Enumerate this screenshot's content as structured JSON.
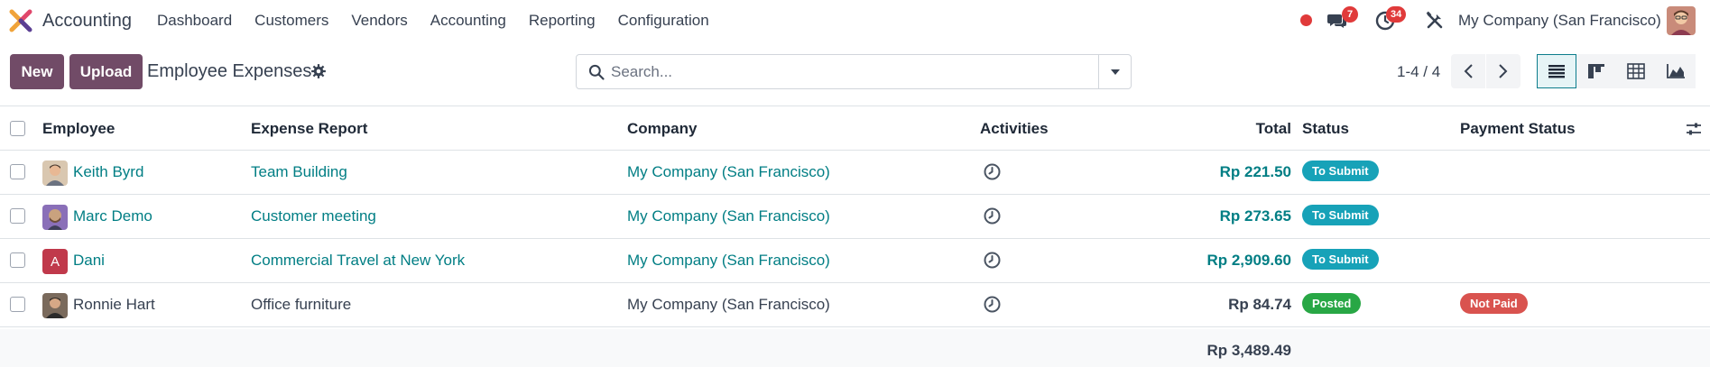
{
  "app": {
    "name": "Accounting",
    "menu": [
      "Dashboard",
      "Customers",
      "Vendors",
      "Accounting",
      "Reporting",
      "Configuration"
    ]
  },
  "systray": {
    "messages_count": "7",
    "activities_count": "34",
    "company": "My Company (San Francisco)"
  },
  "control_panel": {
    "new_label": "New",
    "upload_label": "Upload",
    "title": "Employee Expenses",
    "search_placeholder": "Search...",
    "pager": "1-4 / 4"
  },
  "table": {
    "headers": {
      "employee": "Employee",
      "expense_report": "Expense Report",
      "company": "Company",
      "activities": "Activities",
      "total": "Total",
      "status": "Status",
      "payment_status": "Payment Status"
    },
    "rows": [
      {
        "employee": "Keith Byrd",
        "avatar": "photo-avatar",
        "report": "Team Building",
        "company": "My Company (San Francisco)",
        "total": "Rp 221.50",
        "status": "To Submit",
        "payment_status": ""
      },
      {
        "employee": "Marc Demo",
        "avatar": "photo-avatar",
        "report": "Customer meeting",
        "company": "My Company (San Francisco)",
        "total": "Rp 273.65",
        "status": "To Submit",
        "payment_status": ""
      },
      {
        "employee": "Dani",
        "avatar": "letter-avatar",
        "avatar_letter": "A",
        "report": "Commercial Travel at New York",
        "company": "My Company (San Francisco)",
        "total": "Rp 2,909.60",
        "status": "To Submit",
        "payment_status": ""
      },
      {
        "employee": "Ronnie Hart",
        "avatar": "photo-avatar",
        "report": "Office furniture",
        "company": "My Company (San Francisco)",
        "total": "Rp 84.74",
        "status": "Posted",
        "payment_status": "Not Paid"
      }
    ],
    "grand_total": "Rp 3,489.49"
  },
  "colors": {
    "primary": "#714B67",
    "link": "#017e84",
    "to_submit": "#17a2b8",
    "posted": "#28a745",
    "not_paid": "#d9534f",
    "badge_red": "#e03a3a"
  }
}
